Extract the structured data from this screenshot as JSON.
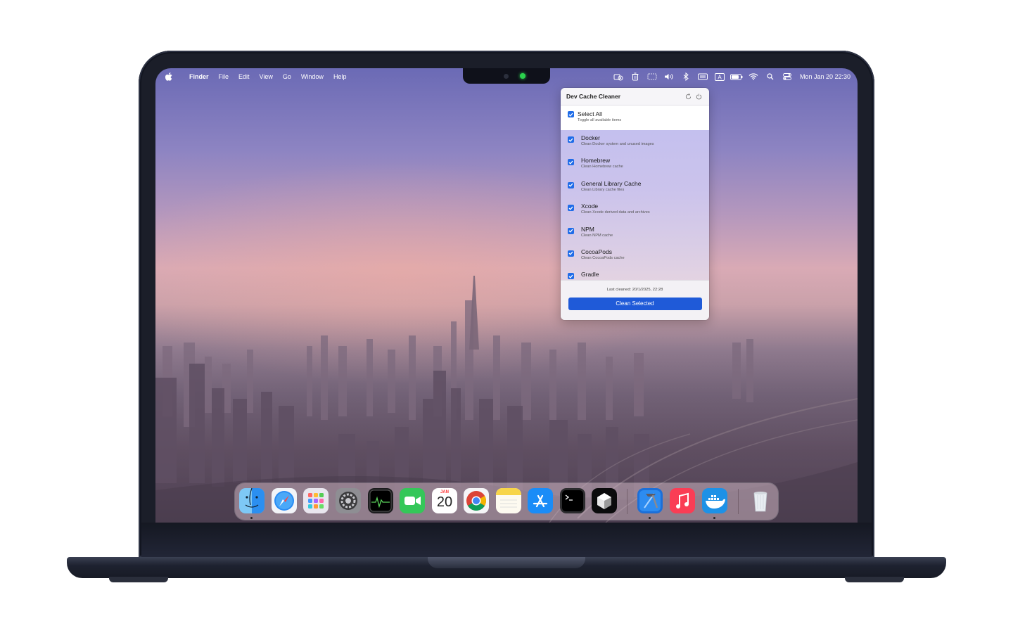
{
  "menubar": {
    "app_name": "Finder",
    "menus": [
      "File",
      "Edit",
      "View",
      "Go",
      "Window",
      "Help"
    ],
    "clock": "Mon Jan 20  22:30",
    "status_icons": [
      "dev-cache-cleaner-icon",
      "trash-icon",
      "screen-icon",
      "volume-icon",
      "bluetooth-icon",
      "keyboard-icon",
      "input-source-icon",
      "battery-icon",
      "wifi-icon",
      "spotlight-icon",
      "control-center-icon"
    ],
    "input_source": "A"
  },
  "popover": {
    "title": "Dev Cache Cleaner",
    "select_all": {
      "label": "Select All",
      "subtitle": "Toggle all available items",
      "checked": true
    },
    "items": [
      {
        "label": "Docker",
        "subtitle": "Clean Docker system and unused images",
        "checked": true
      },
      {
        "label": "Homebrew",
        "subtitle": "Clean Homebrew cache",
        "checked": true
      },
      {
        "label": "General Library Cache",
        "subtitle": "Clean Library cache files",
        "checked": true
      },
      {
        "label": "Xcode",
        "subtitle": "Clean Xcode derived data and archives",
        "checked": true
      },
      {
        "label": "NPM",
        "subtitle": "Clean NPM cache",
        "checked": true
      },
      {
        "label": "CocoaPods",
        "subtitle": "Clean CocoaPods cache",
        "checked": true
      },
      {
        "label": "Gradle",
        "subtitle": "",
        "checked": true
      }
    ],
    "last_cleaned": "Last cleaned: 20/1/2025, 22:28",
    "clean_button": "Clean Selected",
    "accent_color": "#1f5ad8"
  },
  "dock": {
    "calendar": {
      "month": "JAN",
      "day": "20"
    },
    "apps": [
      "Finder",
      "Safari",
      "Launchpad",
      "System Settings",
      "Activity Monitor",
      "FaceTime",
      "Calendar",
      "Chrome",
      "Notes",
      "App Store",
      "Terminal",
      "Cursor",
      "Xcode",
      "Music",
      "Docker",
      "Trash"
    ]
  }
}
